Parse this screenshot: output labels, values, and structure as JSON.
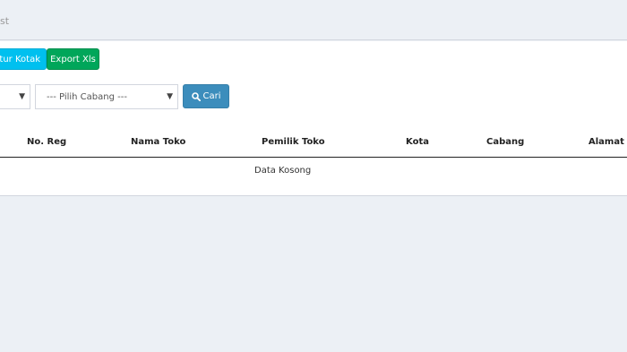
{
  "breadcrumb": "st",
  "toolbar": {
    "aqua_label": "atur Kotak",
    "export_label": "Export Xls"
  },
  "filters": {
    "branch_select": "--- Pilih Cabang ---",
    "search_label": "Cari"
  },
  "table": {
    "columns": [
      "No. Reg",
      "Nama Toko",
      "Pemilik Toko",
      "Kota",
      "Cabang",
      "Alamat"
    ],
    "empty_text": "Data Kosong"
  },
  "colors": {
    "aqua": "#00c0ef",
    "green": "#00a65a",
    "primary": "#3c8dbc",
    "background": "#ecf0f5"
  }
}
